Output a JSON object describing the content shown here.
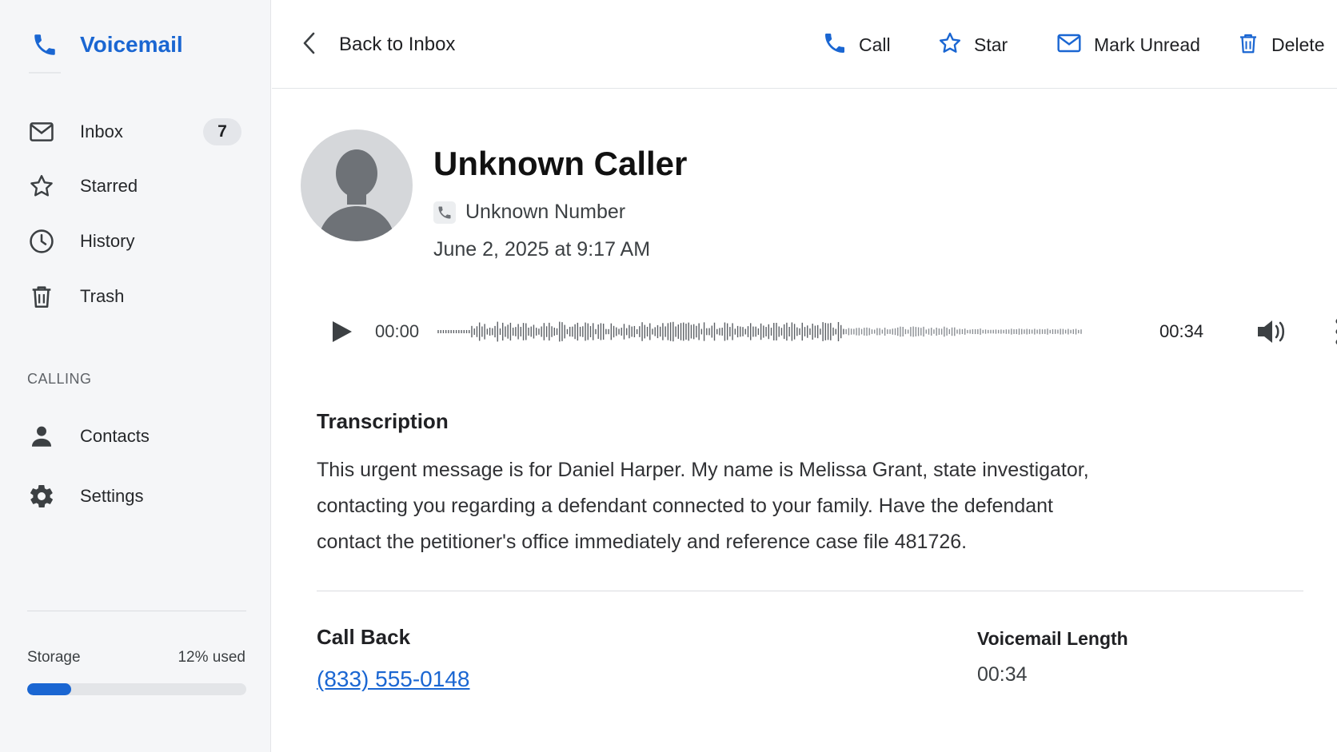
{
  "colors": {
    "accent": "#1a66d2",
    "sidebar_bg": "#f5f6f8",
    "text_primary": "#202124",
    "badge_bg": "#e4e6ea"
  },
  "sidebar": {
    "app_name": "Voicemail",
    "app_icon": "phone-icon",
    "items": [
      {
        "label": "Inbox",
        "icon": "mail-icon",
        "badge": "7"
      },
      {
        "label": "Starred",
        "icon": "star-icon"
      },
      {
        "label": "History",
        "icon": "clock-icon"
      },
      {
        "label": "Trash",
        "icon": "trash-icon"
      }
    ],
    "section_label": "CALLING",
    "calling_items": [
      {
        "label": "Contacts",
        "icon": "person-icon"
      },
      {
        "label": "Settings",
        "icon": "gear-icon"
      }
    ],
    "storage": {
      "label": "Storage",
      "used_text": "12% used",
      "used_fraction": 0.2
    }
  },
  "toolbar": {
    "back_label": "Back to Inbox",
    "call_label": "Call",
    "star_label": "Star",
    "mark_unread_label": "Mark Unread",
    "delete_label": "Delete"
  },
  "message": {
    "caller_name": "Unknown Caller",
    "number_label": "Unknown Number",
    "date_line": "June 2, 2025 at 9:17 AM",
    "player": {
      "current_time": "00:00",
      "total_time": "00:34"
    },
    "transcription_title": "Transcription",
    "transcription_lines": [
      "This urgent message is for Daniel Harper. My name is Melissa Grant, state investigator,",
      "contacting you regarding a defendant connected to your family. Have the defendant",
      "contact the petitioner's office immediately and reference case file 481726."
    ],
    "callback_title": "Call Back",
    "callback_number": "(833) 555-0148",
    "length_title": "Voicemail Length",
    "length_value": "00:34"
  }
}
